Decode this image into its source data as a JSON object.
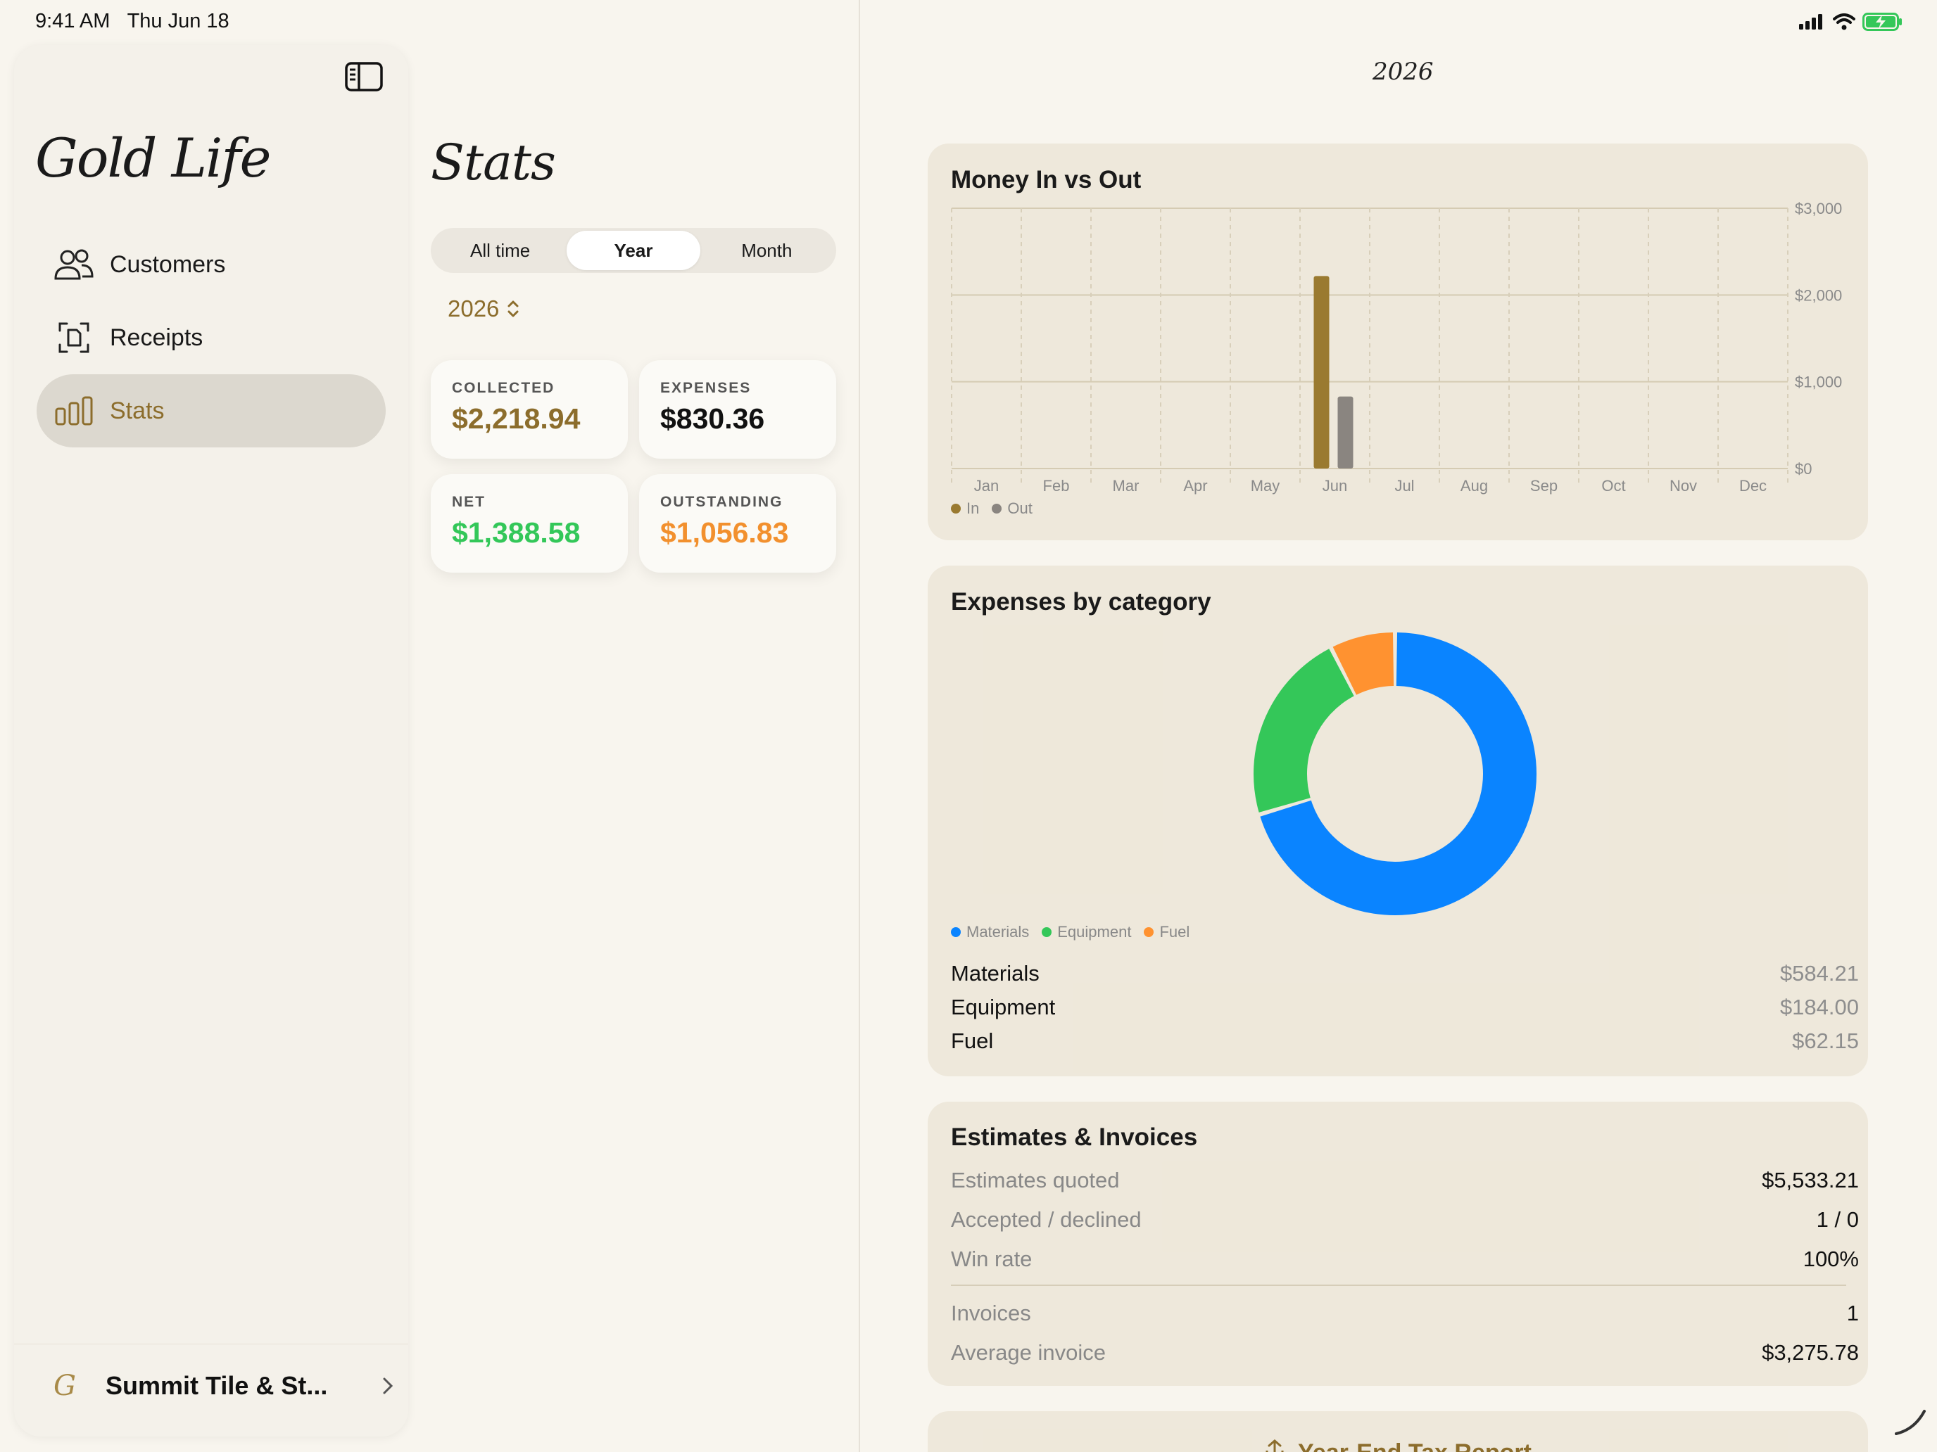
{
  "status_bar": {
    "time": "9:41 AM",
    "date": "Thu Jun 18"
  },
  "sidebar": {
    "logo": "Gold Life",
    "items": [
      {
        "label": "Customers",
        "icon": "people-icon"
      },
      {
        "label": "Receipts",
        "icon": "receipt-scan-icon"
      },
      {
        "label": "Stats",
        "icon": "bar-chart-icon",
        "active": true
      }
    ],
    "account": {
      "name": "Summit Tile & St...",
      "icon": "monogram-logo-icon"
    }
  },
  "stats": {
    "title": "Stats",
    "segments": [
      "All time",
      "Year",
      "Month"
    ],
    "selected_segment": "Year",
    "year": "2026",
    "cards": [
      {
        "label": "COLLECTED",
        "value": "$2,218.94",
        "color": "#8c6d2c"
      },
      {
        "label": "EXPENSES",
        "value": "$830.36",
        "color": "#111111"
      },
      {
        "label": "NET",
        "value": "$1,388.58",
        "color": "#33c759"
      },
      {
        "label": "OUTSTANDING",
        "value": "$1,056.83",
        "color": "#f2902e"
      }
    ]
  },
  "detail": {
    "year_title": "2026",
    "money_chart": {
      "title": "Money In vs Out",
      "legend": [
        "In",
        "Out"
      ]
    },
    "expenses_chart": {
      "title": "Expenses by category",
      "categories": [
        {
          "name": "Materials",
          "amount": "$584.21"
        },
        {
          "name": "Equipment",
          "amount": "$184.00"
        },
        {
          "name": "Fuel",
          "amount": "$62.15"
        }
      ]
    },
    "estimates": {
      "title": "Estimates & Invoices",
      "rows": [
        {
          "label": "Estimates quoted",
          "value": "$5,533.21"
        },
        {
          "label": "Accepted / declined",
          "value": "1 / 0"
        },
        {
          "label": "Win rate",
          "value": "100%"
        }
      ],
      "rows2": [
        {
          "label": "Invoices",
          "value": "1"
        },
        {
          "label": "Average invoice",
          "value": "$3,275.78"
        }
      ]
    },
    "bottom_button": "Year-End Tax Report"
  },
  "colors": {
    "gold": "#8c6d2c",
    "out_gray": "#888888",
    "materials": "#0a84ff",
    "equipment": "#34c759",
    "fuel": "#ff9230"
  },
  "chart_data": [
    {
      "type": "bar",
      "title": "Money In vs Out",
      "categories": [
        "Jan",
        "Feb",
        "Mar",
        "Apr",
        "May",
        "Jun",
        "Jul",
        "Aug",
        "Sep",
        "Oct",
        "Nov",
        "Dec"
      ],
      "series": [
        {
          "name": "In",
          "values": [
            0,
            0,
            0,
            0,
            0,
            2218.94,
            0,
            0,
            0,
            0,
            0,
            0
          ],
          "color": "#9a7a30"
        },
        {
          "name": "Out",
          "values": [
            0,
            0,
            0,
            0,
            0,
            830.36,
            0,
            0,
            0,
            0,
            0,
            0
          ],
          "color": "#8a8580"
        }
      ],
      "yticks": [
        "$0",
        "$1,000",
        "$2,000",
        "$3,000"
      ],
      "ylim": [
        0,
        3000
      ],
      "legend_position": "bottom-left"
    },
    {
      "type": "pie",
      "title": "Expenses by category",
      "series": [
        {
          "name": "Materials",
          "value": 584.21,
          "color": "#0a84ff"
        },
        {
          "name": "Equipment",
          "value": 184.0,
          "color": "#34c759"
        },
        {
          "name": "Fuel",
          "value": 62.15,
          "color": "#ff9230"
        }
      ],
      "legend_position": "bottom-left"
    }
  ]
}
